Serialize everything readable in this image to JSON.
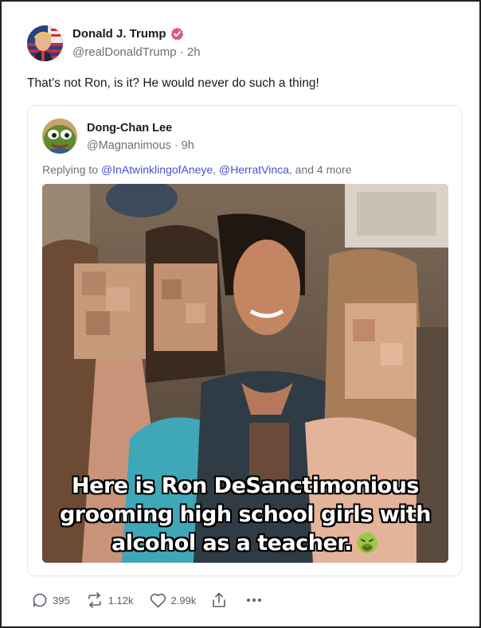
{
  "post": {
    "author_name": "Donald J. Trump",
    "handle": "@realDonaldTrump",
    "separator": "·",
    "time": "2h",
    "text": "That’s not Ron, is it? He would never do such a thing!",
    "verified_color": "#e0567a"
  },
  "quote": {
    "author_name": "Dong-Chan Lee",
    "handle": "@Magnanimous",
    "separator": "·",
    "time": "9h",
    "reply_prefix": "Replying to",
    "mention_1": "@InAtwinklingofAneye",
    "comma": ",",
    "mention_2": "@HerratVinca",
    "reply_suffix": ", and 4 more",
    "image_caption": {
      "line_1": "Here is Ron DeSanctimonious",
      "line_2": "grooming high school girls with",
      "line_3": "alcohol as a teacher."
    },
    "mention_color": "#4a4fd1"
  },
  "actions": {
    "replies": "395",
    "reposts": "1.12k",
    "likes": "2.99k"
  },
  "icons": [
    "verified-badge-icon",
    "reply-icon",
    "repost-icon",
    "like-icon",
    "share-icon",
    "more-icon",
    "nauseated-face-emoji"
  ]
}
